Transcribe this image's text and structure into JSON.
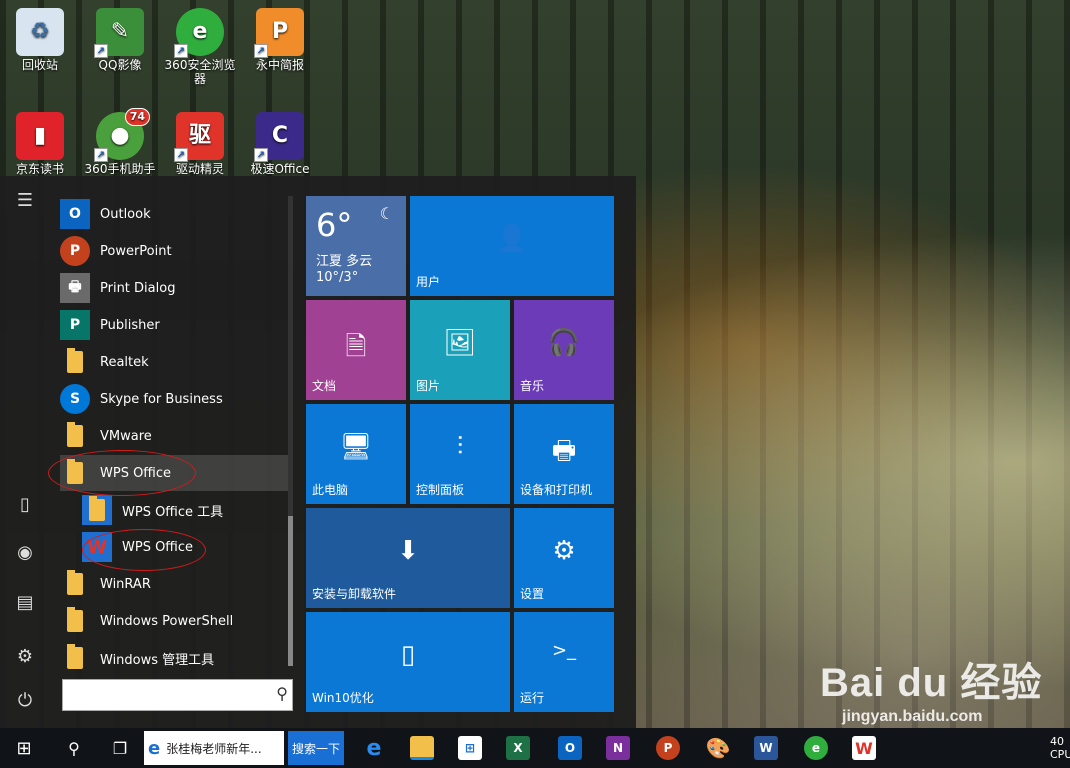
{
  "desktop": {
    "icons": [
      {
        "label": "回收站",
        "name": "recycle-bin-icon",
        "color": "#d8e4ef",
        "glyph": "♻",
        "textColor": "#3a6fa5"
      },
      {
        "label": "QQ影像",
        "name": "qq-image-icon",
        "color": "#3b8f3b",
        "glyph": "✎"
      },
      {
        "label": "360安全浏览器",
        "name": "360-browser-icon",
        "color": "#2fae3e",
        "glyph": "e"
      },
      {
        "label": "永中简报",
        "name": "yozo-slides-icon",
        "color": "#f08c2a",
        "glyph": "P"
      },
      {
        "label": "京东读书",
        "name": "jd-reader-icon",
        "color": "#e0232b",
        "glyph": "▮"
      },
      {
        "label": "360手机助手",
        "name": "360-phone-assistant-icon",
        "color": "#4aa03c",
        "glyph": "●",
        "badge": "74"
      },
      {
        "label": "驱动精灵",
        "name": "driver-genius-icon",
        "color": "#e0342b",
        "glyph": "驱"
      },
      {
        "label": "极速Office",
        "name": "speed-office-icon",
        "color": "#3b2a8a",
        "glyph": "C"
      }
    ]
  },
  "start_menu": {
    "apps": [
      {
        "label": "Outlook",
        "icon": "outlook-icon",
        "color": "#0a64c0",
        "glyph": "O"
      },
      {
        "label": "PowerPoint",
        "icon": "powerpoint-icon",
        "color": "#c3421d",
        "glyph": "P"
      },
      {
        "label": "Print Dialog",
        "icon": "printer-icon",
        "color": "#6a6a6a",
        "glyph": "🖶"
      },
      {
        "label": "Publisher",
        "icon": "publisher-icon",
        "color": "#077568",
        "glyph": "P"
      },
      {
        "label": "Realtek",
        "icon": "folder-icon",
        "color": "",
        "glyph": "folder"
      },
      {
        "label": "Skype for Business",
        "icon": "skype-icon",
        "color": "#0078d7",
        "glyph": "S"
      },
      {
        "label": "VMware",
        "icon": "folder-icon",
        "color": "",
        "glyph": "folder"
      },
      {
        "label": "WPS Office",
        "icon": "folder-icon",
        "color": "",
        "glyph": "folder",
        "selected": true
      },
      {
        "label": "WPS Office 工具",
        "icon": "folder-icon",
        "color": "#1e6fd0",
        "glyph": "folder",
        "sub": true
      },
      {
        "label": "WPS Office",
        "icon": "wps-icon",
        "color": "#1e6fd0",
        "glyph": "W",
        "sub": true
      },
      {
        "label": "WinRAR",
        "icon": "folder-icon",
        "color": "",
        "glyph": "folder"
      },
      {
        "label": "Windows PowerShell",
        "icon": "folder-icon",
        "color": "",
        "glyph": "folder"
      },
      {
        "label": "Windows 管理工具",
        "icon": "folder-icon",
        "color": "",
        "glyph": "folder"
      }
    ],
    "search": {
      "placeholder": ""
    },
    "tiles": [
      {
        "label": "用户",
        "name": "tile-user",
        "color": "#0a78d4",
        "glyph": "👤"
      },
      {
        "label": "文档",
        "name": "tile-documents",
        "color": "#a04193",
        "glyph": "🗎"
      },
      {
        "label": "图片",
        "name": "tile-pictures",
        "color": "#1aa0b8",
        "glyph": "🖼"
      },
      {
        "label": "音乐",
        "name": "tile-music",
        "color": "#6c3bb8",
        "glyph": "🎧"
      },
      {
        "label": "此电脑",
        "name": "tile-this-pc",
        "color": "#0a78d4",
        "glyph": "🖥"
      },
      {
        "label": "控制面板",
        "name": "tile-control-panel",
        "color": "#0a78d4",
        "glyph": "⚙"
      },
      {
        "label": "设备和打印机",
        "name": "tile-devices-printers",
        "color": "#0a78d4",
        "glyph": "🖶"
      },
      {
        "label": "安装与卸载软件",
        "name": "tile-install-uninstall",
        "color": "#1e5a9c",
        "glyph": "⬇"
      },
      {
        "label": "设置",
        "name": "tile-settings",
        "color": "#0a78d4",
        "glyph": "⚙"
      },
      {
        "label": "Win10优化",
        "name": "tile-win10-optimize",
        "color": "#0a78d4",
        "glyph": "▯"
      },
      {
        "label": "运行",
        "name": "tile-run",
        "color": "#0a78d4",
        "glyph": ">_"
      }
    ],
    "weather": {
      "temp": "6°",
      "city": "江夏 多云",
      "range": "10°/3°",
      "color": "#4a6ea8"
    }
  },
  "taskbar": {
    "browser_tab": "张桂梅老师新年...",
    "search_btn": "搜索一下",
    "clock": "40",
    "cpu": "CPU"
  },
  "watermark": {
    "brand": "Bai du 经验",
    "url": "jingyan.baidu.com"
  }
}
